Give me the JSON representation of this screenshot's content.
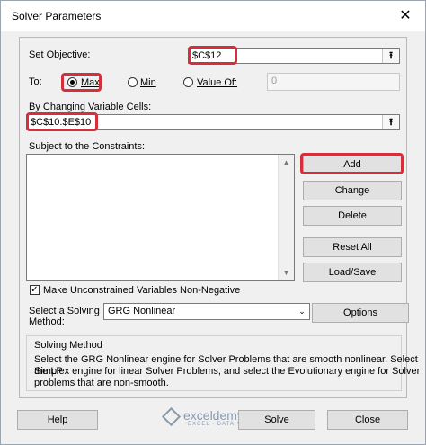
{
  "window": {
    "title": "Solver Parameters",
    "close_glyph": "✕"
  },
  "objective": {
    "label": "Set Objective:",
    "value": "$C$12",
    "ref_icon": "upload-arrow-icon",
    "ref_glyph": "⭱"
  },
  "to": {
    "label": "To:",
    "options": [
      {
        "label": "Max",
        "selected": true
      },
      {
        "label": "Min",
        "selected": false
      },
      {
        "label": "Value Of:",
        "selected": false
      }
    ],
    "value_of": "0"
  },
  "changing_cells": {
    "label": "By Changing Variable Cells:",
    "value": "$C$10:$E$10",
    "ref_glyph": "⭱"
  },
  "constraints": {
    "label": "Subject to the Constraints:",
    "items": []
  },
  "buttons": {
    "add": "Add",
    "change": "Change",
    "delete": "Delete",
    "reset_all": "Reset All",
    "load_save": "Load/Save",
    "options": "Options",
    "help": "Help",
    "solve": "Solve",
    "close": "Close"
  },
  "nonnegative": {
    "label": "Make Unconstrained Variables Non-Negative",
    "checked": true,
    "check_glyph": "✓"
  },
  "method": {
    "label_line1": "Select a Solving",
    "label_line2": "Method:",
    "value": "GRG Nonlinear",
    "arrow": "⌄"
  },
  "solving_method": {
    "title": "Solving Method",
    "lines": [
      "Select the GRG Nonlinear engine for Solver Problems that are smooth nonlinear. Select the LP",
      "Simplex engine for linear Solver Problems, and select the Evolutionary engine for Solver",
      "problems that are non-smooth."
    ]
  },
  "watermark": {
    "name": "exceldemy",
    "tagline": "EXCEL · DATA · BI"
  },
  "colors": {
    "highlight": "#d32f3c",
    "window_bg": "#f0f0f0",
    "button_bg": "#e1e1e1"
  }
}
